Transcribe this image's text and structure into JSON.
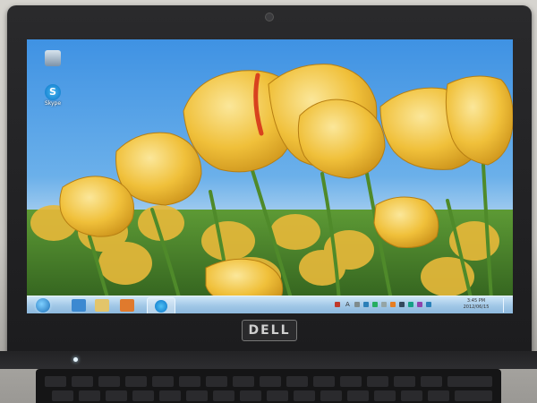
{
  "desktop": {
    "icons": [
      {
        "label": "",
        "icon": "recycle-bin-icon"
      },
      {
        "label": "Skype",
        "icon": "skype-icon"
      }
    ],
    "wallpaper": "yellow-tulips"
  },
  "taskbar": {
    "start_icon": "windows-start-icon",
    "pinned": [
      "internet-explorer-icon",
      "explorer-icon",
      "media-player-icon",
      "skype-icon"
    ],
    "tray": {
      "language": "A",
      "clock_time": "3:45 PM",
      "clock_date": "2012/06/15"
    }
  },
  "laptop": {
    "brand": "DELL"
  },
  "colors": {
    "sky": "#3a8fe0",
    "tulip": "#f2c23a",
    "stem": "#4f8a2a",
    "bezel": "#1c1c1e"
  }
}
